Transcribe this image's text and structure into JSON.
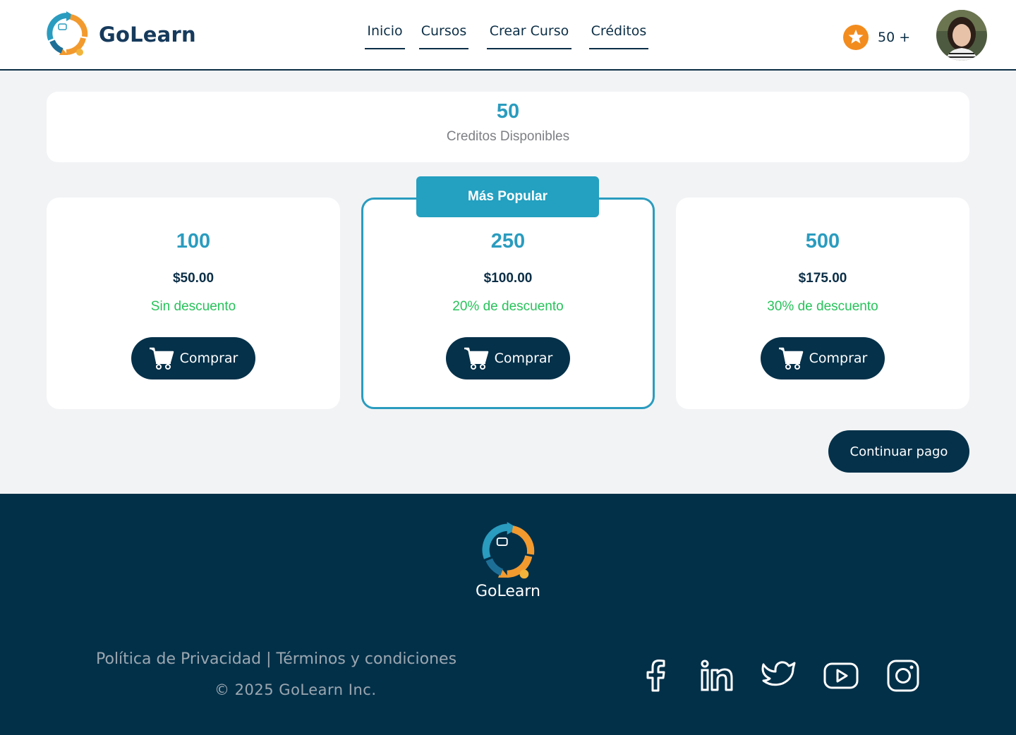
{
  "header": {
    "brand": "GoLearn",
    "nav": [
      {
        "label": "Inicio"
      },
      {
        "label": "Cursos"
      },
      {
        "label": "Crear Curso"
      },
      {
        "label": "Créditos"
      }
    ],
    "credits_count": "50 +",
    "credits_icon": "star-icon"
  },
  "balance": {
    "value": "50",
    "label": "Creditos Disponibles"
  },
  "packages": [
    {
      "credits": "100",
      "price": "$50.00",
      "discount": "Sin descuento",
      "button": "Comprar"
    },
    {
      "credits": "250",
      "price": "$100.00",
      "discount": "20% de descuento",
      "button": "Comprar",
      "tag": "Más Popular"
    },
    {
      "credits": "500",
      "price": "$175.00",
      "discount": "30% de descuento",
      "button": "Comprar"
    }
  ],
  "continue_label": "Continuar pago",
  "footer": {
    "brand": "GoLearn",
    "privacy": "Política de Privacidad",
    "separator": " | ",
    "terms": "Términos y condiciones",
    "copyright": "© 2025 GoLearn Inc.",
    "social": [
      "facebook-icon",
      "linkedin-icon",
      "twitter-icon",
      "youtube-icon",
      "instagram-icon"
    ]
  },
  "colors": {
    "primary_dark": "#05314a",
    "accent": "#2a9cbf",
    "discount": "#27c25a",
    "star": "#f28c1e"
  }
}
